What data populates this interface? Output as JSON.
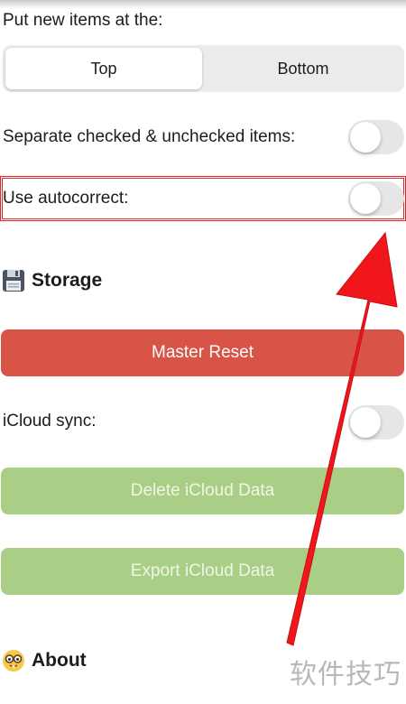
{
  "settings": {
    "new_items_label": "Put new items at the:",
    "position_options": [
      "Top",
      "Bottom"
    ],
    "position_selected": "Top",
    "separate_label": "Separate checked & unchecked items:",
    "separate_enabled": false,
    "autocorrect_label": "Use autocorrect:",
    "autocorrect_enabled": false
  },
  "storage": {
    "icon": "floppy-disk-icon",
    "title": "Storage",
    "master_reset_label": "Master Reset",
    "icloud_sync_label": "iCloud sync:",
    "icloud_sync_enabled": false,
    "delete_icloud_label": "Delete iCloud Data",
    "export_icloud_label": "Export iCloud Data"
  },
  "about": {
    "icon": "nerd-face-icon",
    "title": "About"
  },
  "watermark": "软件技巧",
  "colors": {
    "master_reset": "#d85447",
    "icloud_buttons": "#a9cf86",
    "highlight": "#e0262b",
    "arrow": "#f0161b"
  }
}
